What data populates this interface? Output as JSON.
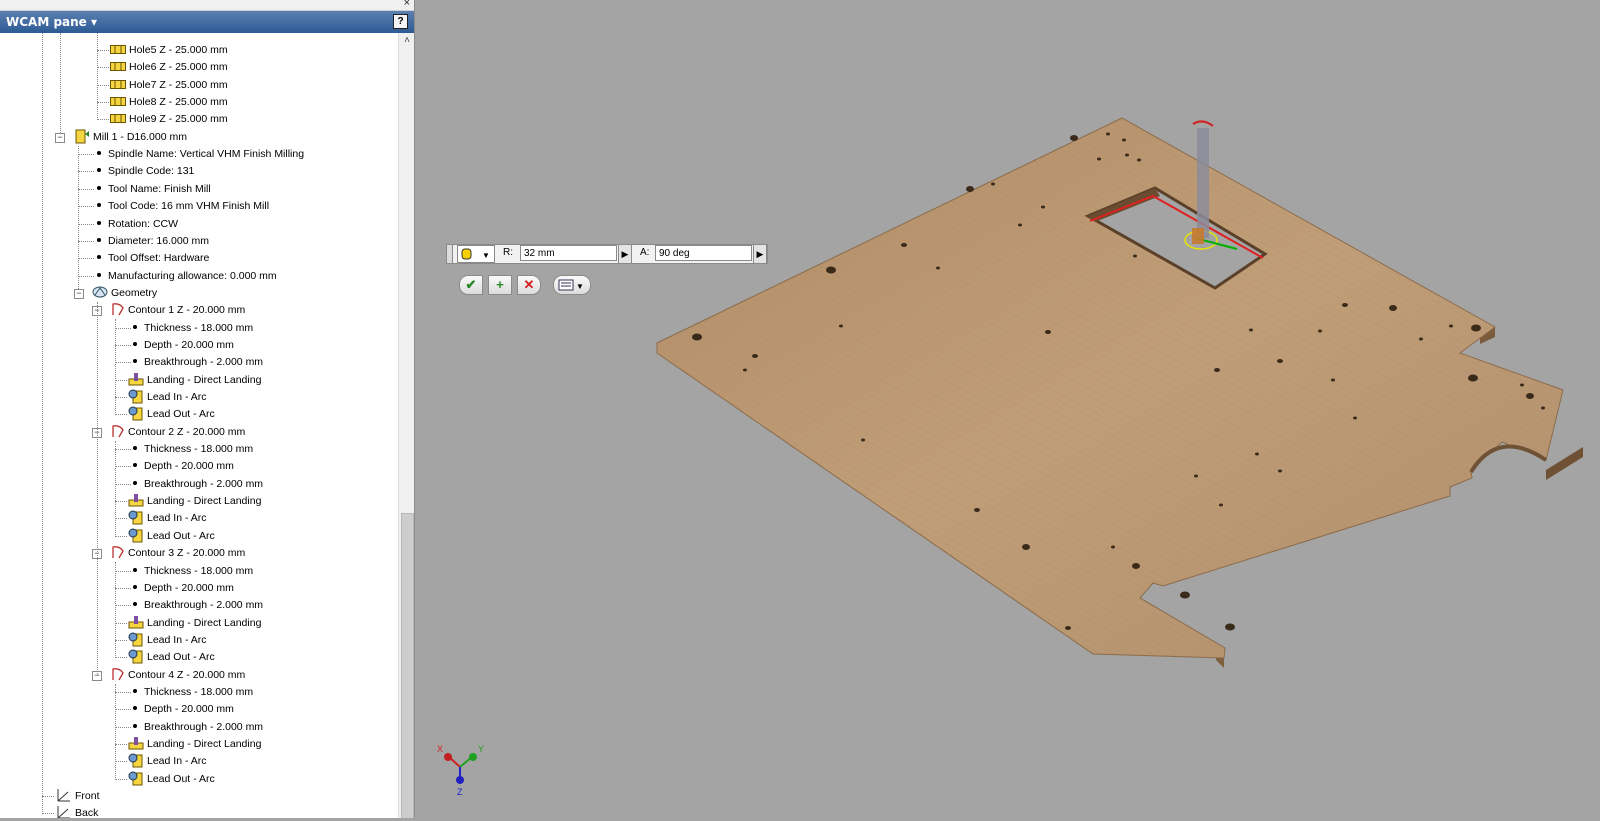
{
  "pane": {
    "title": "WCAM pane ▾",
    "close": "×",
    "help": "?"
  },
  "tree": {
    "holes": [
      "Hole5 Z - 25.000 mm",
      "Hole6 Z - 25.000 mm",
      "Hole7 Z - 25.000 mm",
      "Hole8 Z - 25.000 mm",
      "Hole9 Z - 25.000 mm"
    ],
    "mill": "Mill 1 - D16.000 mm",
    "mill_props": [
      "Spindle Name: Vertical VHM Finish Milling",
      "Spindle Code: 131",
      "Tool Name: Finish Mill",
      "Tool Code: 16 mm VHM Finish Mill",
      "Rotation: CCW",
      "Diameter: 16.000 mm",
      "Tool Offset: Hardware",
      "Manufacturing allowance: 0.000 mm"
    ],
    "geometry": "Geometry",
    "contours": [
      {
        "label": "Contour 1 Z - 20.000 mm",
        "props": [
          "Thickness - 18.000 mm",
          "Depth - 20.000 mm",
          "Breakthrough - 2.000 mm"
        ],
        "landing": "Landing - Direct Landing",
        "lead_in": "Lead In - Arc",
        "lead_out": "Lead Out - Arc"
      },
      {
        "label": "Contour 2 Z - 20.000 mm",
        "props": [
          "Thickness - 18.000 mm",
          "Depth - 20.000 mm",
          "Breakthrough - 2.000 mm"
        ],
        "landing": "Landing - Direct Landing",
        "lead_in": "Lead In - Arc",
        "lead_out": "Lead Out - Arc"
      },
      {
        "label": "Contour 3 Z - 20.000 mm",
        "props": [
          "Thickness - 18.000 mm",
          "Depth - 20.000 mm",
          "Breakthrough - 2.000 mm"
        ],
        "landing": "Landing - Direct Landing",
        "lead_in": "Lead In - Arc",
        "lead_out": "Lead Out - Arc"
      },
      {
        "label": "Contour 4 Z - 20.000 mm",
        "props": [
          "Thickness - 18.000 mm",
          "Depth - 20.000 mm",
          "Breakthrough - 2.000 mm"
        ],
        "landing": "Landing - Direct Landing",
        "lead_in": "Lead In - Arc",
        "lead_out": "Lead Out - Arc"
      }
    ],
    "views": [
      "Front",
      "Back"
    ]
  },
  "toolbar": {
    "r_label": "R:",
    "r_value": "32 mm",
    "a_label": "A:",
    "a_value": "90 deg",
    "ok": "✔",
    "add": "+",
    "cancel": "✕"
  },
  "axes": {
    "x": "X",
    "y": "Y",
    "z": "Z"
  },
  "colors": {
    "header": "#3a66a0",
    "wood": "#b89670",
    "viewport": "#a4a4a4",
    "toolpath": "#e02020",
    "tool": "#8c8c9a"
  },
  "icons": {
    "hole": "hole-icon",
    "mill": "mill-tool-icon",
    "geometry": "geometry-icon",
    "contour": "contour-icon",
    "landing": "landing-icon",
    "lead": "lead-icon",
    "view": "view-axis-icon"
  }
}
